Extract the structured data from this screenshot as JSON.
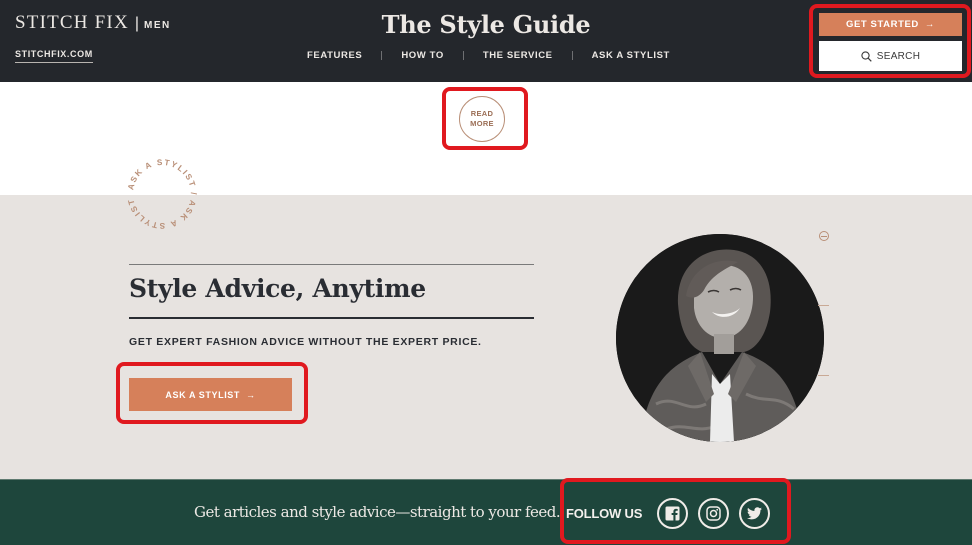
{
  "header": {
    "brand_name": "STITCH FIX",
    "brand_separator": "|",
    "brand_sub": "MEN",
    "site_link": "STITCHFIX.COM",
    "title": "The Style Guide",
    "nav": [
      {
        "label": "FEATURES"
      },
      {
        "label": "HOW TO"
      },
      {
        "label": "THE SERVICE"
      },
      {
        "label": "ASK A STYLIST"
      }
    ],
    "get_started_label": "GET STARTED",
    "get_started_arrow": "→",
    "search_label": "SEARCH",
    "search_icon": "search-icon"
  },
  "read_more": {
    "line1": "READ",
    "line2": "MORE"
  },
  "ask_section": {
    "badge_text": "ASK A STYLIST / ASK A STYLIST /",
    "headline": "Style Advice, Anytime",
    "subhead": "GET EXPERT FASHION ADVICE WITHOUT THE EXPERT PRICE.",
    "button_label": "ASK A STYLIST",
    "button_arrow": "→",
    "photo_alt": "Smiling stylist in denim jacket"
  },
  "follow": {
    "text": "Get articles and style advice—straight to your feed.",
    "label": "FOLLOW US",
    "social": [
      {
        "name": "facebook",
        "icon": "facebook-icon"
      },
      {
        "name": "instagram",
        "icon": "instagram-icon"
      },
      {
        "name": "twitter",
        "icon": "twitter-icon"
      }
    ]
  },
  "colors": {
    "header_bg": "#24272c",
    "accent": "#d6805a",
    "section_bg": "#e7e3e0",
    "footer_bg": "#1e463c",
    "highlight": "#e0191f",
    "text_dark": "#2a2d33",
    "copper": "#b98f77"
  }
}
